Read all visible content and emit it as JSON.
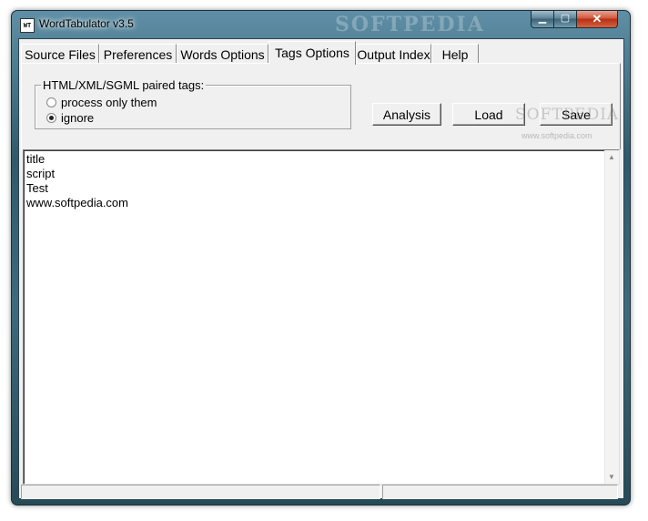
{
  "window": {
    "title": "WordTabulator v3.5",
    "icon_label": "WT",
    "title_watermark": "SOFTPEDIA",
    "close_glyph": "✕",
    "maximize_glyph": "▢",
    "minimize_glyph": "▁"
  },
  "tabs": [
    {
      "label": "Source Files"
    },
    {
      "label": "Preferences"
    },
    {
      "label": "Words Options"
    },
    {
      "label": "Tags Options"
    },
    {
      "label": "Output Index"
    },
    {
      "label": "Help"
    }
  ],
  "active_tab": "Tags Options",
  "tag_group": {
    "legend": "HTML/XML/SGML paired tags:",
    "options": [
      {
        "label": "process only them",
        "selected": false
      },
      {
        "label": "ignore",
        "selected": true
      }
    ]
  },
  "buttons": {
    "analysis": "Analysis",
    "load": "Load",
    "save": "Save"
  },
  "watermark": {
    "text": "SOFTPEDIA",
    "url": "www.softpedia.com"
  },
  "list_items": [
    "title",
    "script",
    "Test",
    "www.softpedia.com"
  ],
  "colors": {
    "frame": "#3d6b7d",
    "close_button": "#c9452a",
    "client_bg": "#f0f0f0"
  }
}
